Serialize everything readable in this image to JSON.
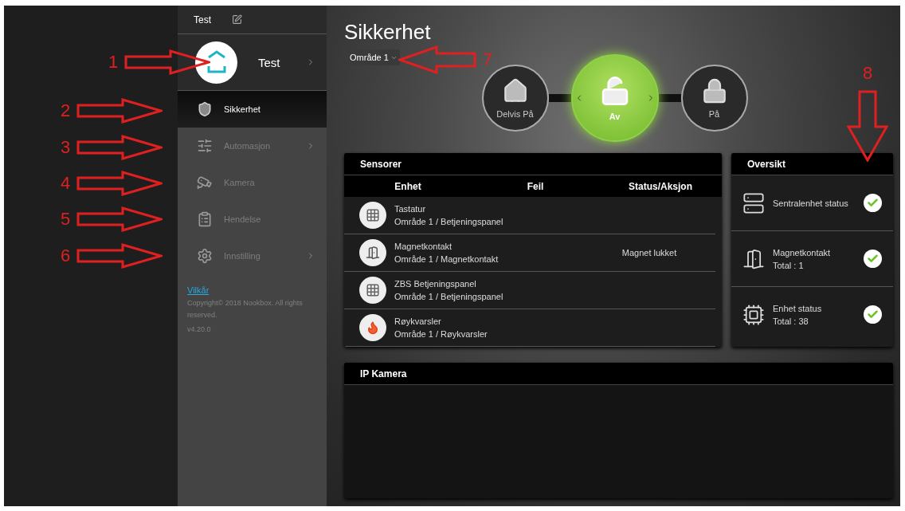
{
  "sidebar": {
    "top_label": "Test",
    "profile": {
      "name": "Test"
    },
    "menu": [
      {
        "kind": "shield",
        "label": "Sikkerhet",
        "selected": true,
        "submenu": false
      },
      {
        "kind": "sliders",
        "label": "Automasjon",
        "selected": false,
        "submenu": true
      },
      {
        "kind": "camera",
        "label": "Kamera",
        "selected": false,
        "submenu": false
      },
      {
        "kind": "list",
        "label": "Hendelse",
        "selected": false,
        "submenu": false
      },
      {
        "kind": "gear",
        "label": "Innstilling",
        "selected": false,
        "submenu": true
      }
    ],
    "footer": {
      "link": "Vilkår",
      "copyright": "Copyright© 2018 Nookbox. All rights reserved.",
      "version": "v4.20.0"
    }
  },
  "main": {
    "title": "Sikkerhet",
    "area_dropdown": "Område 1",
    "modes": [
      {
        "kind": "home",
        "label": "Delvis På",
        "selected": false
      },
      {
        "kind": "unlocked",
        "label": "Av",
        "selected": true
      },
      {
        "kind": "locked",
        "label": "På",
        "selected": false
      }
    ],
    "sensors": {
      "title": "Sensorer",
      "columns": [
        "Enhet",
        "Feil",
        "Status/Aksjon"
      ],
      "rows": [
        {
          "kind": "keypad",
          "name": "Tastatur",
          "location": "Område 1 / Betjeningspanel"
        },
        {
          "kind": "door",
          "name": "Magnetkontakt",
          "location": "Område 1 / Magnetkontakt",
          "status": "Magnet lukket"
        },
        {
          "kind": "keypad",
          "name": "ZBS Betjeningspanel",
          "location": "Område 1 / Betjeningspanel"
        },
        {
          "kind": "smoke",
          "name": "Røykvarsler",
          "location": "Område 1 / Røykvarsler"
        }
      ]
    },
    "overview": {
      "title": "Oversikt",
      "items": [
        {
          "kind": "hub",
          "label": "Sentralenhet status",
          "ok": true
        },
        {
          "kind": "door",
          "label": "Magnetkontakt",
          "total": "Total :  1",
          "ok": true
        },
        {
          "kind": "chip",
          "label": "Enhet status",
          "total": "Total : 38",
          "ok": true
        }
      ]
    },
    "camera": {
      "title": "IP Kamera"
    }
  },
  "annotations": [
    {
      "label": "1",
      "kind": "right"
    },
    {
      "label": "2",
      "kind": "right"
    },
    {
      "label": "3",
      "kind": "right"
    },
    {
      "label": "4",
      "kind": "right"
    },
    {
      "label": "5",
      "kind": "right"
    },
    {
      "label": "6",
      "kind": "right"
    },
    {
      "label": "7",
      "kind": "left"
    },
    {
      "label": "8",
      "kind": "down"
    }
  ]
}
